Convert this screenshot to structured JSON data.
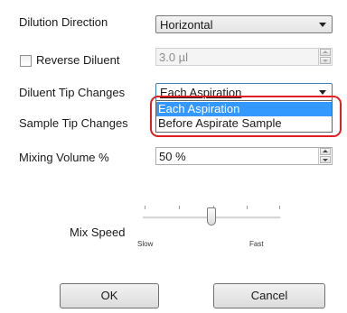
{
  "dilution_direction": {
    "label": "Dilution Direction",
    "value": "Horizontal"
  },
  "reverse_diluent": {
    "label": "Reverse Diluent",
    "checked": false,
    "value": "3.0 µl"
  },
  "diluent_tip_changes": {
    "label": "Diluent Tip Changes",
    "value": "Each Aspiration",
    "options": [
      "Each Aspiration",
      "Before Aspirate Sample"
    ],
    "selected_option": "Each Aspiration"
  },
  "sample_tip_changes": {
    "label": "Sample Tip Changes"
  },
  "mixing_volume": {
    "label": "Mixing Volume %",
    "value": "50 %"
  },
  "mix_speed": {
    "label": "Mix Speed",
    "min_label": "Slow",
    "max_label": "Fast",
    "level": 0.5
  },
  "buttons": {
    "ok": "OK",
    "cancel": "Cancel"
  },
  "colors": {
    "highlight": "#e02020",
    "selection": "#3399ff"
  },
  "icons": [
    "chevron-down-icon",
    "spin-up-icon",
    "spin-down-icon",
    "checkbox-icon"
  ]
}
